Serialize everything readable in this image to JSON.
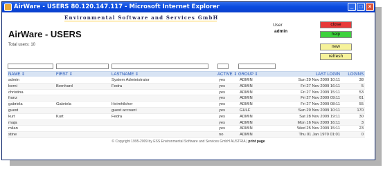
{
  "window": {
    "title": "AirWare - USERS 80.120.147.117 - Microsoft Internet Explorer",
    "controls": {
      "minimize": "_",
      "maximize": "□",
      "close": "×"
    }
  },
  "header": {
    "company": "Environmental Software and Services GmbH",
    "app_title": "AirWare - USERS",
    "total_users": "Total users: 10",
    "user_label": "User",
    "user_name": "admin"
  },
  "buttons": {
    "close": "close",
    "help": "help",
    "new": "new",
    "refresh": "refresh"
  },
  "colors": {
    "close": "#e83a3a",
    "help": "#3ed23e",
    "new": "#f6f29a",
    "refresh": "#f6f29a",
    "header_row": "#d8e4f4",
    "header_text": "#1b4fb5"
  },
  "filters": {
    "name": "",
    "first": "",
    "lastname": "",
    "active": "",
    "group": ""
  },
  "table": {
    "columns": {
      "name": "NAME ⇕",
      "first": "FIRST ⇕",
      "lastname": "LASTNAME ⇕",
      "active": "ACTIVE ⇕",
      "group": "GROUP ⇕",
      "last_login": "LAST LOGIN",
      "logins": "LOGINS"
    },
    "rows": [
      {
        "name": "admin",
        "first": "",
        "lastname": "System Administrator",
        "active": "yes",
        "group": "ADMIN",
        "last_login": "Sun 29 Nov 2009 10:11",
        "logins": "38"
      },
      {
        "name": "berni",
        "first": "Bernhard",
        "lastname": "Fedra",
        "active": "yes",
        "group": "ADMIN",
        "last_login": "Fri 27 Nov 2009 16:11",
        "logins": "5"
      },
      {
        "name": "christina",
        "first": "",
        "lastname": "",
        "active": "yes",
        "group": "ADMIN",
        "last_login": "Fri 27 Nov 2009 15:11",
        "logins": "53"
      },
      {
        "name": "franz",
        "first": "",
        "lastname": "",
        "active": "yes",
        "group": "ADMIN",
        "last_login": "Fri 27 Nov 2009 09:11",
        "logins": "61"
      },
      {
        "name": "gabriela",
        "first": "Gabriela",
        "lastname": "Heimhilcher",
        "active": "yes",
        "group": "ADMIN",
        "last_login": "Fri 27 Nov 2009 08:11",
        "logins": "55"
      },
      {
        "name": "guest",
        "first": "",
        "lastname": "guest account",
        "active": "yes",
        "group": "GULF",
        "last_login": "Sun 29 Nov 2009 10:11",
        "logins": "170"
      },
      {
        "name": "kurt",
        "first": "Kurt",
        "lastname": "Fedra",
        "active": "yes",
        "group": "ADMIN",
        "last_login": "Sat 28 Nov 2009 19:11",
        "logins": "30"
      },
      {
        "name": "maja",
        "first": "",
        "lastname": "",
        "active": "yes",
        "group": "ADMIN",
        "last_login": "Mon 16 Nov 2009 16:11",
        "logins": "3"
      },
      {
        "name": "milan",
        "first": "",
        "lastname": "",
        "active": "yes",
        "group": "ADMIN",
        "last_login": "Wed 25 Nov 2009 15:11",
        "logins": "23"
      },
      {
        "name": "stine",
        "first": "",
        "lastname": "",
        "active": "no",
        "group": "ADMIN",
        "last_login": "Thu 01 Jan 1970 01:01",
        "logins": "0"
      }
    ]
  },
  "footer": {
    "copyright": "© Copyright 1995-2009 by   ESS  Environmental Software and Services GmbH AUSTRIA | ",
    "print_page": "print page"
  }
}
